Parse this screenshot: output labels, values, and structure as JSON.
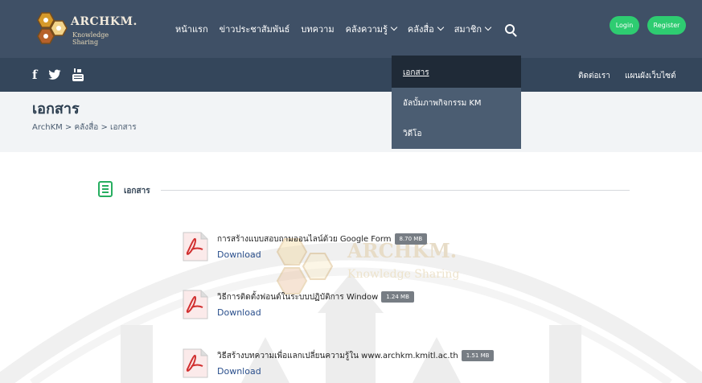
{
  "header": {
    "logo_title": "ARCHKM.",
    "logo_subtitle": "Knowledge Sharing",
    "nav": [
      {
        "label": "หน้าแรก",
        "has_dropdown": false
      },
      {
        "label": "ข่าวประชาสัมพันธ์",
        "has_dropdown": false
      },
      {
        "label": "บทความ",
        "has_dropdown": false
      },
      {
        "label": "คลังความรู้",
        "has_dropdown": true
      },
      {
        "label": "คลังสื่อ",
        "has_dropdown": true
      },
      {
        "label": "สมาชิก",
        "has_dropdown": true
      }
    ],
    "login_label": "Login",
    "register_label": "Register"
  },
  "secondary_bar": {
    "social": [
      "f",
      "twitter",
      "youtube"
    ],
    "contact_label": "ติดต่อเรา",
    "sitemap_label": "แผนผังเว็บไซต์"
  },
  "dropdown": {
    "items": [
      {
        "label": "เอกสาร",
        "active": true
      },
      {
        "label": "อัลบั้มภาพกิจกรรม KM",
        "active": false
      },
      {
        "label": "วิดีโอ",
        "active": false
      }
    ]
  },
  "page": {
    "title": "เอกสาร",
    "breadcrumb": "ArchKM > คลังสื่อ > เอกสาร"
  },
  "section": {
    "label": "เอกสาร"
  },
  "documents": [
    {
      "title": "การสร้างแบบสอบถามออนไลน์ด้วย Google Form",
      "size": "8.70 MB",
      "link": "Download"
    },
    {
      "title": "วิธีการติดตั้งฟอนต์ในระบบปฏิบัติการ Window",
      "size": "1.24 MB",
      "link": "Download"
    },
    {
      "title": "วิธีสร้างบทความเพื่อแลกเปลี่ยนความรู้ใน www.archkm.kmitl.ac.th",
      "size": "1.51 MB",
      "link": "Download"
    }
  ],
  "watermark": {
    "title": "ARCHKM.",
    "subtitle": "Knowledge Sharing"
  },
  "colors": {
    "header_bg": "#3f5066",
    "secondary_bg": "#34465b",
    "accent_green": "#2ecc71",
    "link_blue": "#2a4f8c"
  }
}
